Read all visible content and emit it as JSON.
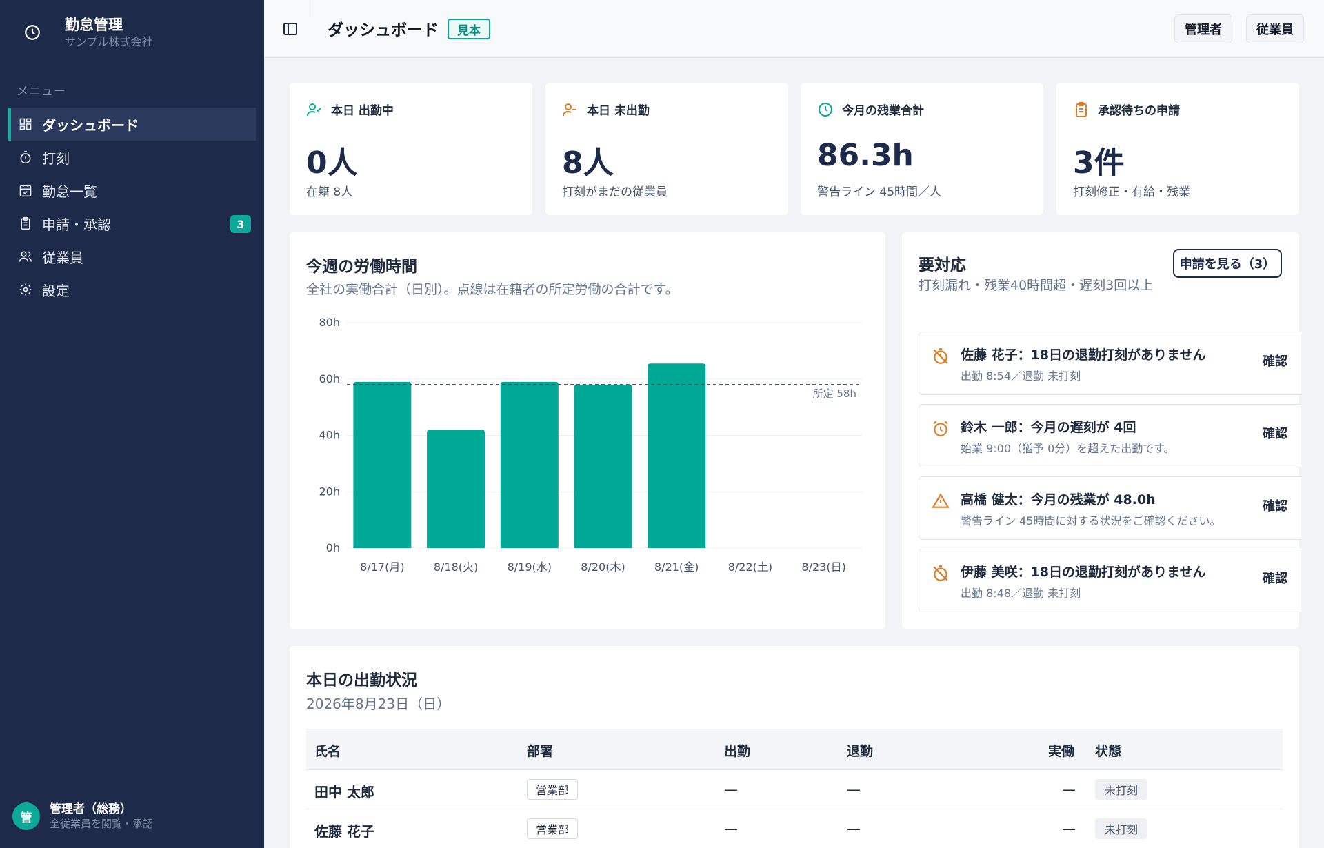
{
  "app": {
    "title": "勤怠管理",
    "company": "サンプル株式会社"
  },
  "sidebar": {
    "menu_label": "メニュー",
    "items": [
      {
        "label": "ダッシュボード",
        "icon": "grid-icon",
        "active": true
      },
      {
        "label": "打刻",
        "icon": "stopwatch-icon"
      },
      {
        "label": "勤怠一覧",
        "icon": "calendar-check-icon"
      },
      {
        "label": "申請・承認",
        "icon": "clipboard-icon",
        "badge": "3"
      },
      {
        "label": "従業員",
        "icon": "users-icon"
      },
      {
        "label": "設定",
        "icon": "gear-icon"
      }
    ],
    "user": {
      "avatar": "管",
      "name": "管理者（総務）",
      "role": "全従業員を閲覧・承認"
    }
  },
  "header": {
    "title": "ダッシュボード",
    "badge": "見本",
    "admin_btn": "管理者",
    "employee_btn": "従業員"
  },
  "stats": [
    {
      "label": "本日 出勤中",
      "value": "0人",
      "sub": "在籍 8人",
      "icon": "user-check-icon",
      "color": "#0ea898"
    },
    {
      "label": "本日 未出勤",
      "value": "8人",
      "sub": "打刻がまだの従業員",
      "icon": "user-minus-icon",
      "color": "#e07b22"
    },
    {
      "label": "今月の残業合計",
      "value": "86.3h",
      "sub": "警告ライン 45時間／人",
      "icon": "clock-icon",
      "color": "#0ea898"
    },
    {
      "label": "承認待ちの申請",
      "value": "3件",
      "sub": "打刻修正・有給・残業",
      "icon": "clipboard-icon",
      "color": "#e07b22"
    }
  ],
  "weekly": {
    "title": "今週の労働時間",
    "subtitle": "全社の実働合計（日別）。点線は在籍者の所定労働の合計です。"
  },
  "chart_data": {
    "type": "bar",
    "categories": [
      "8/17(月)",
      "8/18(火)",
      "8/19(水)",
      "8/20(木)",
      "8/21(金)",
      "8/22(土)",
      "8/23(日)"
    ],
    "values": [
      59,
      42,
      59,
      58,
      65.5,
      0,
      0
    ],
    "ylim": [
      0,
      80
    ],
    "yticks": [
      "0h",
      "20h",
      "40h",
      "60h",
      "80h"
    ],
    "reference_line": {
      "value": 58,
      "label": "所定 58h"
    },
    "color": "#00a896",
    "grid": true
  },
  "attention": {
    "title": "要対応",
    "subtitle": "打刻漏れ・残業40時間超・遅刻3回以上",
    "button": "申請を見る（3）",
    "items": [
      {
        "icon": "timer-off-icon",
        "title": "佐藤 花子：18日の退勤打刻がありません",
        "detail": "出勤 8:54／退勤 未打刻",
        "action": "確認"
      },
      {
        "icon": "alarm-icon",
        "title": "鈴木 一郎：今月の遅刻が 4回",
        "detail": "始業 9:00（猶予 0分）を超えた出勤です。",
        "action": "確認"
      },
      {
        "icon": "warning-icon",
        "title": "高橋 健太：今月の残業が 48.0h",
        "detail": "警告ライン 45時間に対する状況をご確認ください。",
        "action": "確認"
      },
      {
        "icon": "timer-off-icon",
        "title": "伊藤 美咲：18日の退勤打刻がありません",
        "detail": "出勤 8:48／退勤 未打刻",
        "action": "確認"
      }
    ]
  },
  "today": {
    "title": "本日の出勤状況",
    "date": "2026年8月23日（日）",
    "columns": [
      "氏名",
      "部署",
      "出勤",
      "退勤",
      "実働",
      "状態"
    ],
    "rows": [
      {
        "name": "田中 太郎",
        "dept": "営業部",
        "in": "—",
        "out": "—",
        "work": "—",
        "status": "未打刻"
      },
      {
        "name": "佐藤 花子",
        "dept": "営業部",
        "in": "—",
        "out": "—",
        "work": "—",
        "status": "未打刻"
      }
    ]
  }
}
